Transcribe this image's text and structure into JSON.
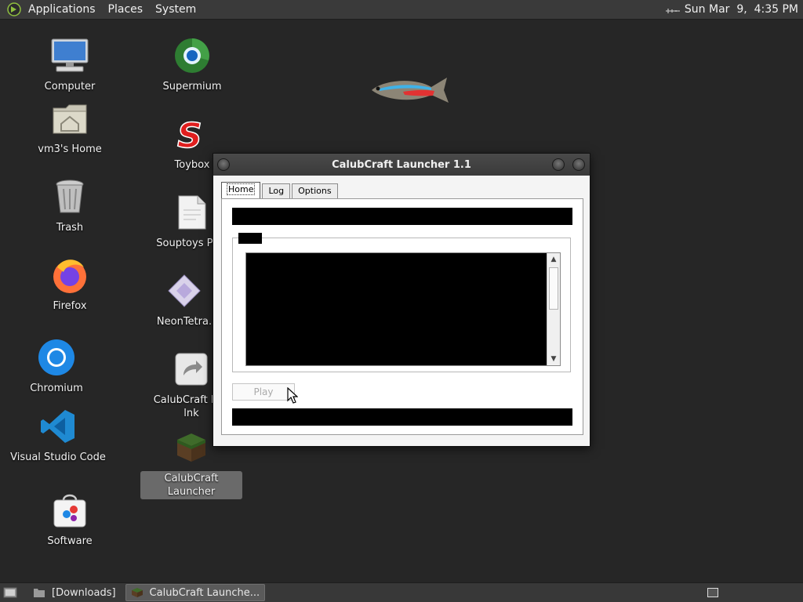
{
  "top_panel": {
    "menus": [
      "Applications",
      "Places",
      "System"
    ],
    "clock": "Sun Mar  9,  4:35 PM"
  },
  "desktop": {
    "icons": [
      {
        "label": "Computer",
        "icon": "computer-icon"
      },
      {
        "label": "vm3's Home",
        "icon": "home-folder-icon"
      },
      {
        "label": "Trash",
        "icon": "trash-icon"
      },
      {
        "label": "Firefox",
        "icon": "firefox-icon"
      },
      {
        "label": "Chromium",
        "icon": "chromium-icon"
      },
      {
        "label": "Visual Studio Code",
        "icon": "vscode-icon"
      },
      {
        "label": "Software",
        "icon": "software-icon"
      },
      {
        "label": "Supermium",
        "icon": "supermium-icon"
      },
      {
        "label": "Toybox",
        "icon": "toybox-icon"
      },
      {
        "label": "Souptoys Play",
        "icon": "document-icon"
      },
      {
        "label": "NeonTetra.",
        "icon": "neontetra-icon"
      },
      {
        "label": "CalubCraft Lau",
        "label2": "lnk",
        "icon": "shortcut-icon"
      },
      {
        "label": "CalubCraft Launcher",
        "icon": "grass-block-icon",
        "selected": true
      }
    ]
  },
  "window": {
    "title": "CalubCraft Launcher 1.1",
    "tabs": [
      "Home",
      "Log",
      "Options"
    ],
    "active_tab": "Home",
    "play_label": "Play",
    "play_enabled": false
  },
  "taskbar": {
    "tasks": [
      {
        "label": "[Downloads]",
        "icon": "folder-icon"
      },
      {
        "label": "CalubCraft Launche...",
        "icon": "grass-block-icon",
        "active": true
      }
    ]
  },
  "colors": {
    "desktop_bg": "#262626",
    "panel_bg": "#3a3a3a",
    "selected_label_bg": "#6a6a6a"
  }
}
